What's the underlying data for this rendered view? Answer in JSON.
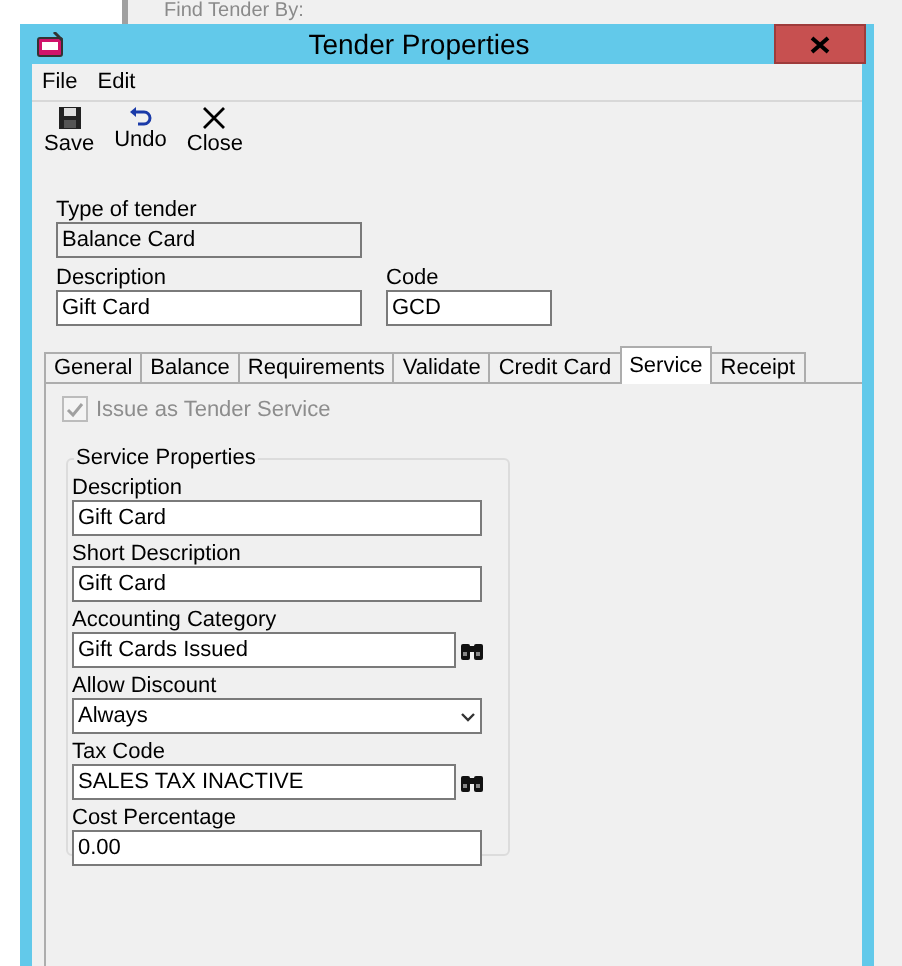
{
  "background": {
    "group_label": "Find Tender By:"
  },
  "window": {
    "title": "Tender Properties"
  },
  "menu": [
    "File",
    "Edit"
  ],
  "toolbar": [
    {
      "kind": "save",
      "label": "Save"
    },
    {
      "kind": "undo",
      "label": "Undo"
    },
    {
      "kind": "close",
      "label": "Close"
    }
  ],
  "type_of_tender": {
    "label": "Type of tender",
    "value": "Balance Card",
    "disabled": true
  },
  "description": {
    "label": "Description",
    "value": "Gift Card"
  },
  "code": {
    "label": "Code",
    "value": "GCD"
  },
  "tabs": [
    {
      "label": "General",
      "selected": false
    },
    {
      "label": "Balance",
      "selected": false
    },
    {
      "label": "Requirements",
      "selected": false
    },
    {
      "label": "Validate",
      "selected": false
    },
    {
      "label": "Credit Card",
      "selected": false
    },
    {
      "label": "Service",
      "selected": true
    },
    {
      "label": "Receipt",
      "selected": false
    }
  ],
  "issue_as_tender_service": {
    "label": "Issue as Tender Service",
    "checked": true,
    "disabled": true
  },
  "service_properties": {
    "title": "Service Properties",
    "fields": [
      {
        "kind": "text",
        "label": "Description",
        "value": "Gift Card"
      },
      {
        "kind": "text",
        "label": "Short Description",
        "value": "Gift Card"
      },
      {
        "kind": "lookup",
        "label": "Accounting Category",
        "value": "Gift Cards Issued"
      },
      {
        "kind": "select",
        "label": "Allow Discount",
        "value": "Always"
      },
      {
        "kind": "lookup",
        "label": "Tax Code",
        "value": "SALES TAX INACTIVE"
      },
      {
        "kind": "text",
        "label": "Cost Percentage",
        "value": "0.00"
      }
    ]
  }
}
